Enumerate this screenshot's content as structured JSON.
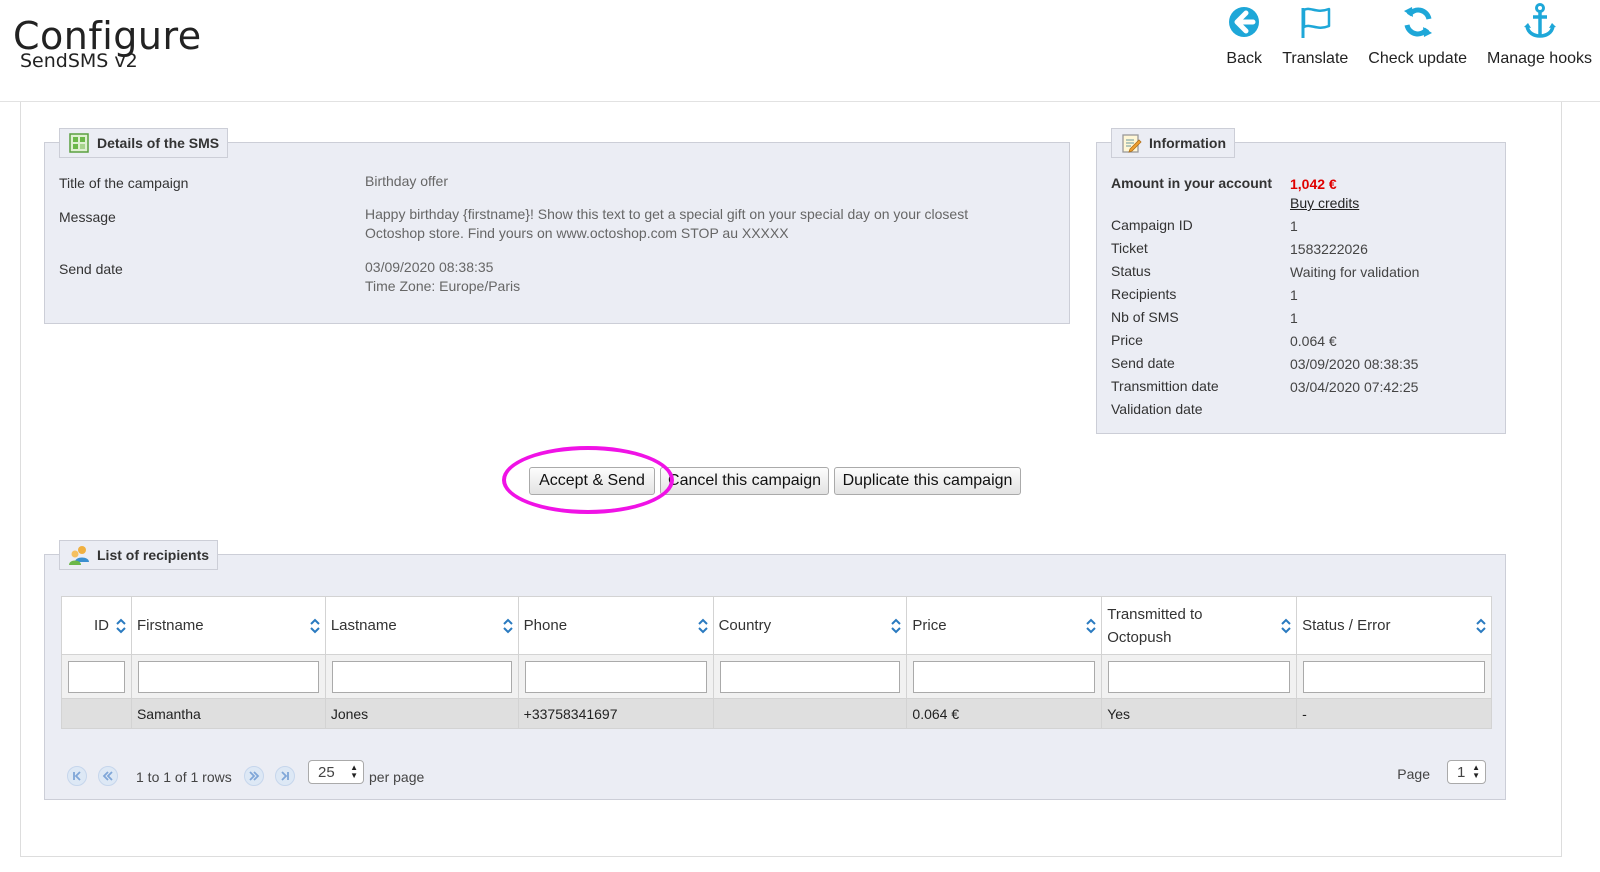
{
  "header": {
    "title": "Configure",
    "subtitle": "SendSMS v2",
    "toolbar": [
      {
        "label": "Back",
        "icon": "back-arrow-icon"
      },
      {
        "label": "Translate",
        "icon": "flag-icon"
      },
      {
        "label": "Check update",
        "icon": "refresh-icon"
      },
      {
        "label": "Manage hooks",
        "icon": "anchor-icon"
      }
    ]
  },
  "details": {
    "legend": "Details of the SMS",
    "title_label": "Title of the campaign",
    "title_value": "Birthday offer",
    "message_label": "Message",
    "message_line1": "Happy birthday {firstname}! Show this text to get a special gift on your special day on your closest",
    "message_line2": "Octoshop store. Find yours on www.octoshop.com STOP au XXXXX",
    "send_date_label": "Send date",
    "send_date_value": "03/09/2020 08:38:35",
    "time_zone": "Time Zone: Europe/Paris"
  },
  "information": {
    "legend": "Information",
    "amount_label": "Amount in your account",
    "amount_value": "1,042 €",
    "buy_credits": "Buy credits",
    "rows": [
      {
        "label": "Campaign ID",
        "value": "1"
      },
      {
        "label": "Ticket",
        "value": "1583222026"
      },
      {
        "label": "Status",
        "value": "Waiting for validation"
      },
      {
        "label": "Recipients",
        "value": "1"
      },
      {
        "label": "Nb of SMS",
        "value": "1"
      },
      {
        "label": "Price",
        "value": "0.064 €"
      },
      {
        "label": "Send date",
        "value": "03/09/2020 08:38:35"
      },
      {
        "label": "Transmittion date",
        "value": "03/04/2020 07:42:25"
      },
      {
        "label": "Validation date",
        "value": ""
      }
    ]
  },
  "actions": {
    "accept": "Accept & Send",
    "cancel": "Cancel this campaign",
    "duplicate": "Duplicate this campaign"
  },
  "recipients": {
    "legend": "List of recipients",
    "columns": [
      "ID",
      "Firstname",
      "Lastname",
      "Phone",
      "Country",
      "Price",
      "Transmitted to Octopush",
      "Status / Error"
    ],
    "rows": [
      [
        "",
        "Samantha",
        "Jones",
        "+33758341697",
        "",
        "0.064 €",
        "Yes",
        "-"
      ]
    ],
    "pager_summary": "1 to 1 of 1 rows",
    "per_page_value": "25",
    "per_page_label": "per page",
    "page_label": "Page",
    "page_value": "1"
  },
  "colors": {
    "accent": "#1ea7d8",
    "amount": "#e00000",
    "highlight": "#f012e6",
    "fieldset_bg": "#ebedf4"
  }
}
